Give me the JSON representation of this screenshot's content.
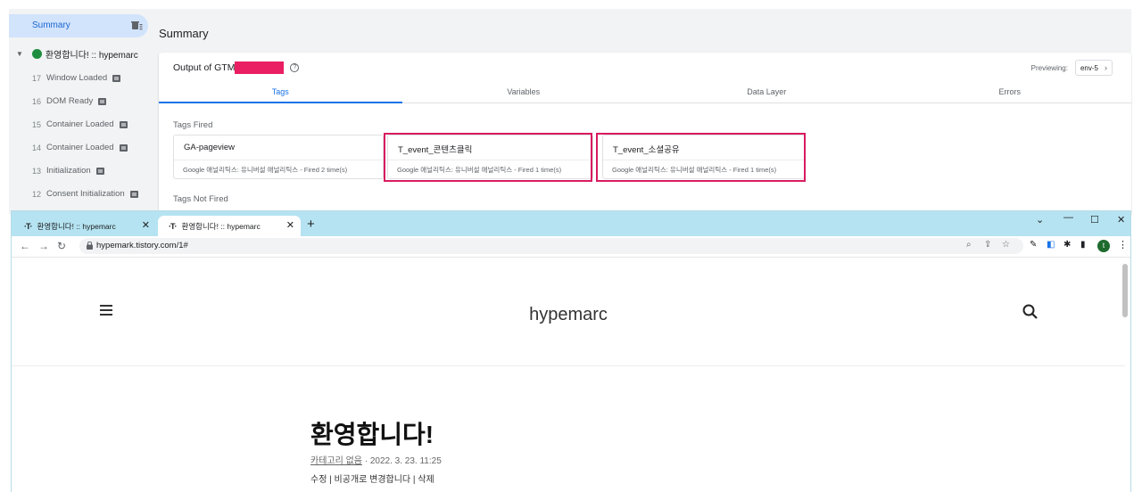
{
  "gtm": {
    "sidebar": {
      "summary_label": "Summary",
      "event_label": "환영합니다! :: hypemarc",
      "items": [
        {
          "num": "17",
          "label": "Window Loaded"
        },
        {
          "num": "16",
          "label": "DOM Ready"
        },
        {
          "num": "15",
          "label": "Container Loaded"
        },
        {
          "num": "14",
          "label": "Container Loaded"
        },
        {
          "num": "13",
          "label": "Initialization"
        },
        {
          "num": "12",
          "label": "Consent Initialization"
        }
      ]
    },
    "main": {
      "title": "Summary",
      "output_label": "Output of GTM",
      "previewing_label": "Previewing:",
      "env_label": "env-5",
      "tabs": [
        "Tags",
        "Variables",
        "Data Layer",
        "Errors"
      ],
      "tags_fired_label": "Tags Fired",
      "tags_not_fired_label": "Tags Not Fired",
      "tags_fired": [
        {
          "name": "GA-pageview",
          "desc": "Google 애널리틱스: 유니버설 애널리틱스 - Fired 2 time(s)",
          "highlighted": false
        },
        {
          "name": "T_event_콘텐츠클릭",
          "desc": "Google 애널리틱스: 유니버설 애널리틱스 - Fired 1 time(s)",
          "highlighted": true
        },
        {
          "name": "T_event_소셜공유",
          "desc": "Google 애널리틱스: 유니버설 애널리틱스 - Fired 1 time(s)",
          "highlighted": true
        }
      ],
      "highlight_color": "#d81b60",
      "redaction_color": "#e91e63",
      "accent_color": "#1a73e8"
    }
  },
  "browser": {
    "tabs": [
      {
        "title": "환영합니다! :: hypemarc",
        "active": false
      },
      {
        "title": "환영합니다! :: hypemarc",
        "active": true
      }
    ],
    "url": "hypemark.tistory.com/1#",
    "profile_initial": "t",
    "titlebar_color": "#b5e3f1"
  },
  "page": {
    "blog_title": "hypemarc",
    "post_title": "환영합니다!",
    "category": "카테고리 없음",
    "date": "· 2022. 3. 23. 11:25",
    "actions": "수정 | 비공개로 변경합니다 | 삭제"
  }
}
